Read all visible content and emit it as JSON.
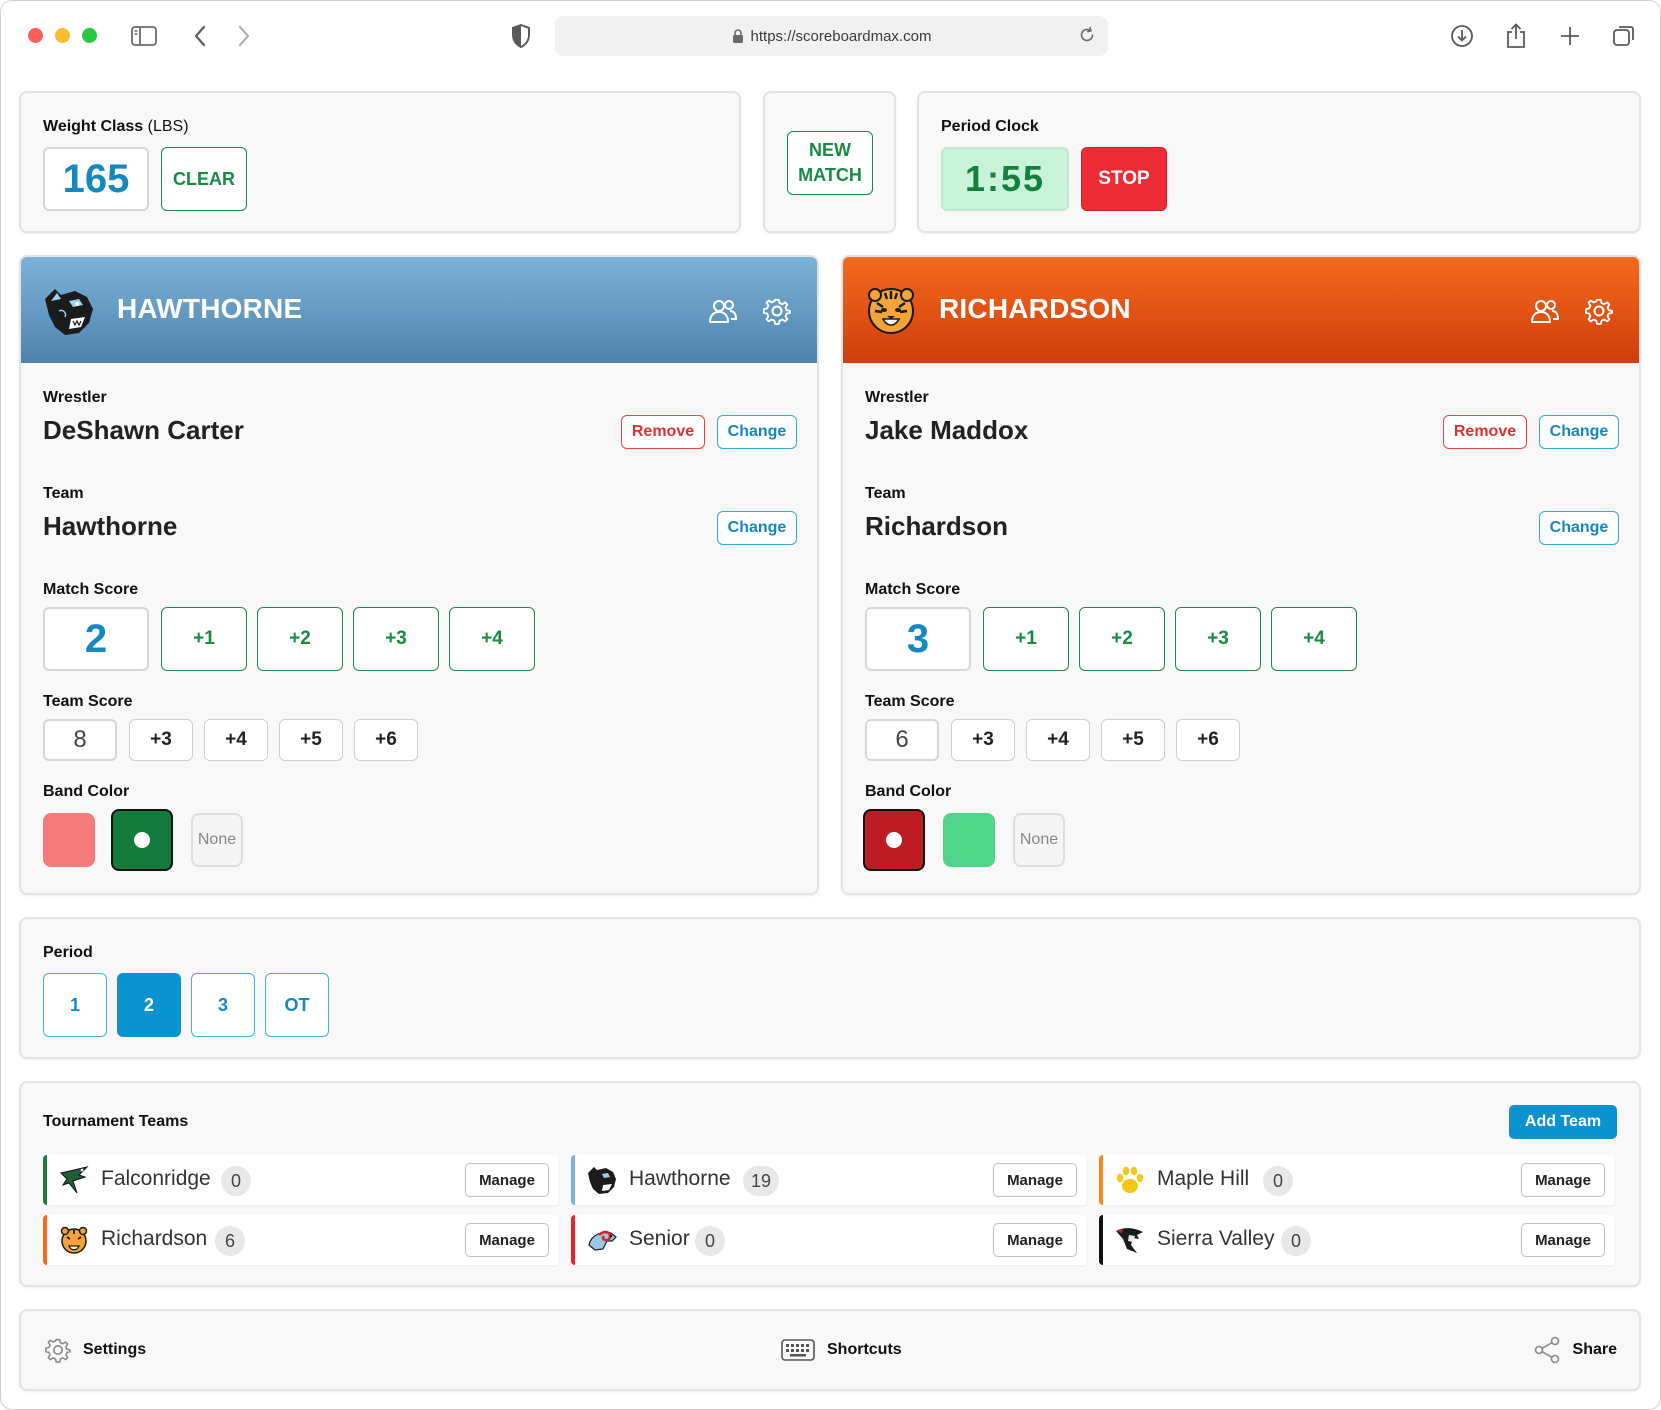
{
  "browser": {
    "url": "https://scoreboardmax.com"
  },
  "weight_class": {
    "label": "Weight Class",
    "unit": "(LBS)",
    "value": "165",
    "clear_label": "CLEAR"
  },
  "new_match": {
    "line1": "NEW",
    "line2": "MATCH"
  },
  "clock": {
    "label": "Period Clock",
    "value": "1:55",
    "stop_label": "STOP"
  },
  "home": {
    "header_name": "HAWTHORNE",
    "color": "#4e83ad",
    "wrestler_label": "Wrestler",
    "wrestler": "DeShawn Carter",
    "remove_label": "Remove",
    "change_label": "Change",
    "team_label": "Team",
    "team": "Hawthorne",
    "team_change_label": "Change",
    "match_score_label": "Match Score",
    "match_score": "2",
    "match_increments": [
      "+1",
      "+2",
      "+3",
      "+4"
    ],
    "team_score_label": "Team Score",
    "team_score": "8",
    "team_increments": [
      "+3",
      "+4",
      "+5",
      "+6"
    ],
    "band_label": "Band Color",
    "band_colors": [
      "#f47a7d",
      "#147a3c"
    ],
    "band_selected": "#147a3c",
    "none_label": "None"
  },
  "away": {
    "header_name": "RICHARDSON",
    "color": "#e8531a",
    "wrestler_label": "Wrestler",
    "wrestler": "Jake Maddox",
    "remove_label": "Remove",
    "change_label": "Change",
    "team_label": "Team",
    "team": "Richardson",
    "team_change_label": "Change",
    "match_score_label": "Match Score",
    "match_score": "3",
    "match_increments": [
      "+1",
      "+2",
      "+3",
      "+4"
    ],
    "team_score_label": "Team Score",
    "team_score": "6",
    "team_increments": [
      "+3",
      "+4",
      "+5",
      "+6"
    ],
    "band_label": "Band Color",
    "band_colors": [
      "#bd1c24",
      "#4fd68a"
    ],
    "band_selected": "#bd1c24",
    "none_label": "None"
  },
  "period": {
    "label": "Period",
    "options": [
      "1",
      "2",
      "3",
      "OT"
    ],
    "selected": "2"
  },
  "tournament": {
    "title": "Tournament Teams",
    "add_label": "Add Team",
    "manage_label": "Manage",
    "teams": [
      {
        "name": "Falconridge",
        "count": "0",
        "color": "#1f7a3f",
        "icon": "falcon-logo-icon"
      },
      {
        "name": "Hawthorne",
        "count": "19",
        "color": "#7fb2d9",
        "icon": "panther-logo-icon"
      },
      {
        "name": "Maple Hill",
        "count": "0",
        "color": "#f08a1e",
        "icon": "paw-logo-icon"
      },
      {
        "name": "Richardson",
        "count": "6",
        "color": "#f06a1e",
        "icon": "tiger-logo-icon"
      },
      {
        "name": "Senior",
        "count": "0",
        "color": "#e3262e",
        "icon": "ram-logo-icon"
      },
      {
        "name": "Sierra Valley",
        "count": "0",
        "color": "#111111",
        "icon": "raider-logo-icon"
      }
    ]
  },
  "footer": {
    "settings_label": "Settings",
    "shortcuts_label": "Shortcuts",
    "share_label": "Share"
  }
}
